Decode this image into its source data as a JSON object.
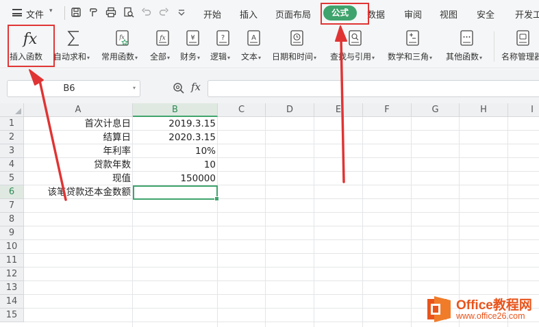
{
  "menu": {
    "file_label": "文件",
    "tabs": [
      "开始",
      "插入",
      "页面布局",
      "公式",
      "数据",
      "审阅",
      "视图",
      "安全",
      "开发工"
    ],
    "active_tab": "公式"
  },
  "ribbon": {
    "buttons": [
      {
        "id": "insert-function",
        "label": "插入函数",
        "icon": "fx-icon",
        "dropdown": false
      },
      {
        "id": "autosum",
        "label": "自动求和",
        "icon": "sigma-icon",
        "dropdown": true
      },
      {
        "id": "common-functions",
        "label": "常用函数",
        "icon": "star-fx-icon",
        "dropdown": true
      },
      {
        "id": "all-functions",
        "label": "全部",
        "icon": "fx-book-icon",
        "dropdown": true
      },
      {
        "id": "financial",
        "label": "财务",
        "icon": "yen-book-icon",
        "dropdown": true
      },
      {
        "id": "logical",
        "label": "逻辑",
        "icon": "question-book-icon",
        "dropdown": true
      },
      {
        "id": "text",
        "label": "文本",
        "icon": "letter-a-book-icon",
        "dropdown": true
      },
      {
        "id": "datetime",
        "label": "日期和时间",
        "icon": "clock-book-icon",
        "dropdown": true
      },
      {
        "id": "lookup",
        "label": "查找与引用",
        "icon": "magnifier-book-icon",
        "dropdown": true
      },
      {
        "id": "math-trig",
        "label": "数学和三角",
        "icon": "plus-minus-book-icon",
        "dropdown": true
      },
      {
        "id": "other-functions",
        "label": "其他函数",
        "icon": "dots-book-icon",
        "dropdown": true
      },
      {
        "id": "name-manager",
        "label": "名称管理器",
        "icon": "name-manager-icon",
        "dropdown": false
      }
    ]
  },
  "formula_bar": {
    "name_box": "B6",
    "fx_label": "fx",
    "formula": ""
  },
  "sheet": {
    "columns": [
      "A",
      "B",
      "C",
      "D",
      "E",
      "F",
      "G",
      "H",
      "I"
    ],
    "selected_column": "B",
    "rows": [
      "1",
      "2",
      "3",
      "4",
      "5",
      "6",
      "7",
      "8",
      "9",
      "10",
      "11",
      "12",
      "13",
      "14",
      "15"
    ],
    "selected_row": "6",
    "active_cell": "B6",
    "cells": [
      {
        "row": "1",
        "a": "首次计息日",
        "b": "2019.3.15"
      },
      {
        "row": "2",
        "a": "结算日",
        "b": "2020.3.15"
      },
      {
        "row": "3",
        "a": "年利率",
        "b": "10%"
      },
      {
        "row": "4",
        "a": "贷款年数",
        "b": "10"
      },
      {
        "row": "5",
        "a": "现值",
        "b": "150000"
      },
      {
        "row": "6",
        "a": "该笔贷款还本金数额",
        "b": ""
      }
    ]
  },
  "annotations": {
    "color": "#e03434",
    "boxes": [
      "insert-function-button",
      "tab-formula"
    ]
  },
  "watermark": {
    "title": "Office教程网",
    "url": "www.office26.com"
  },
  "colors": {
    "accent_green": "#3ea36c",
    "annotation_red": "#e03434",
    "watermark_orange": "#e8541b"
  }
}
